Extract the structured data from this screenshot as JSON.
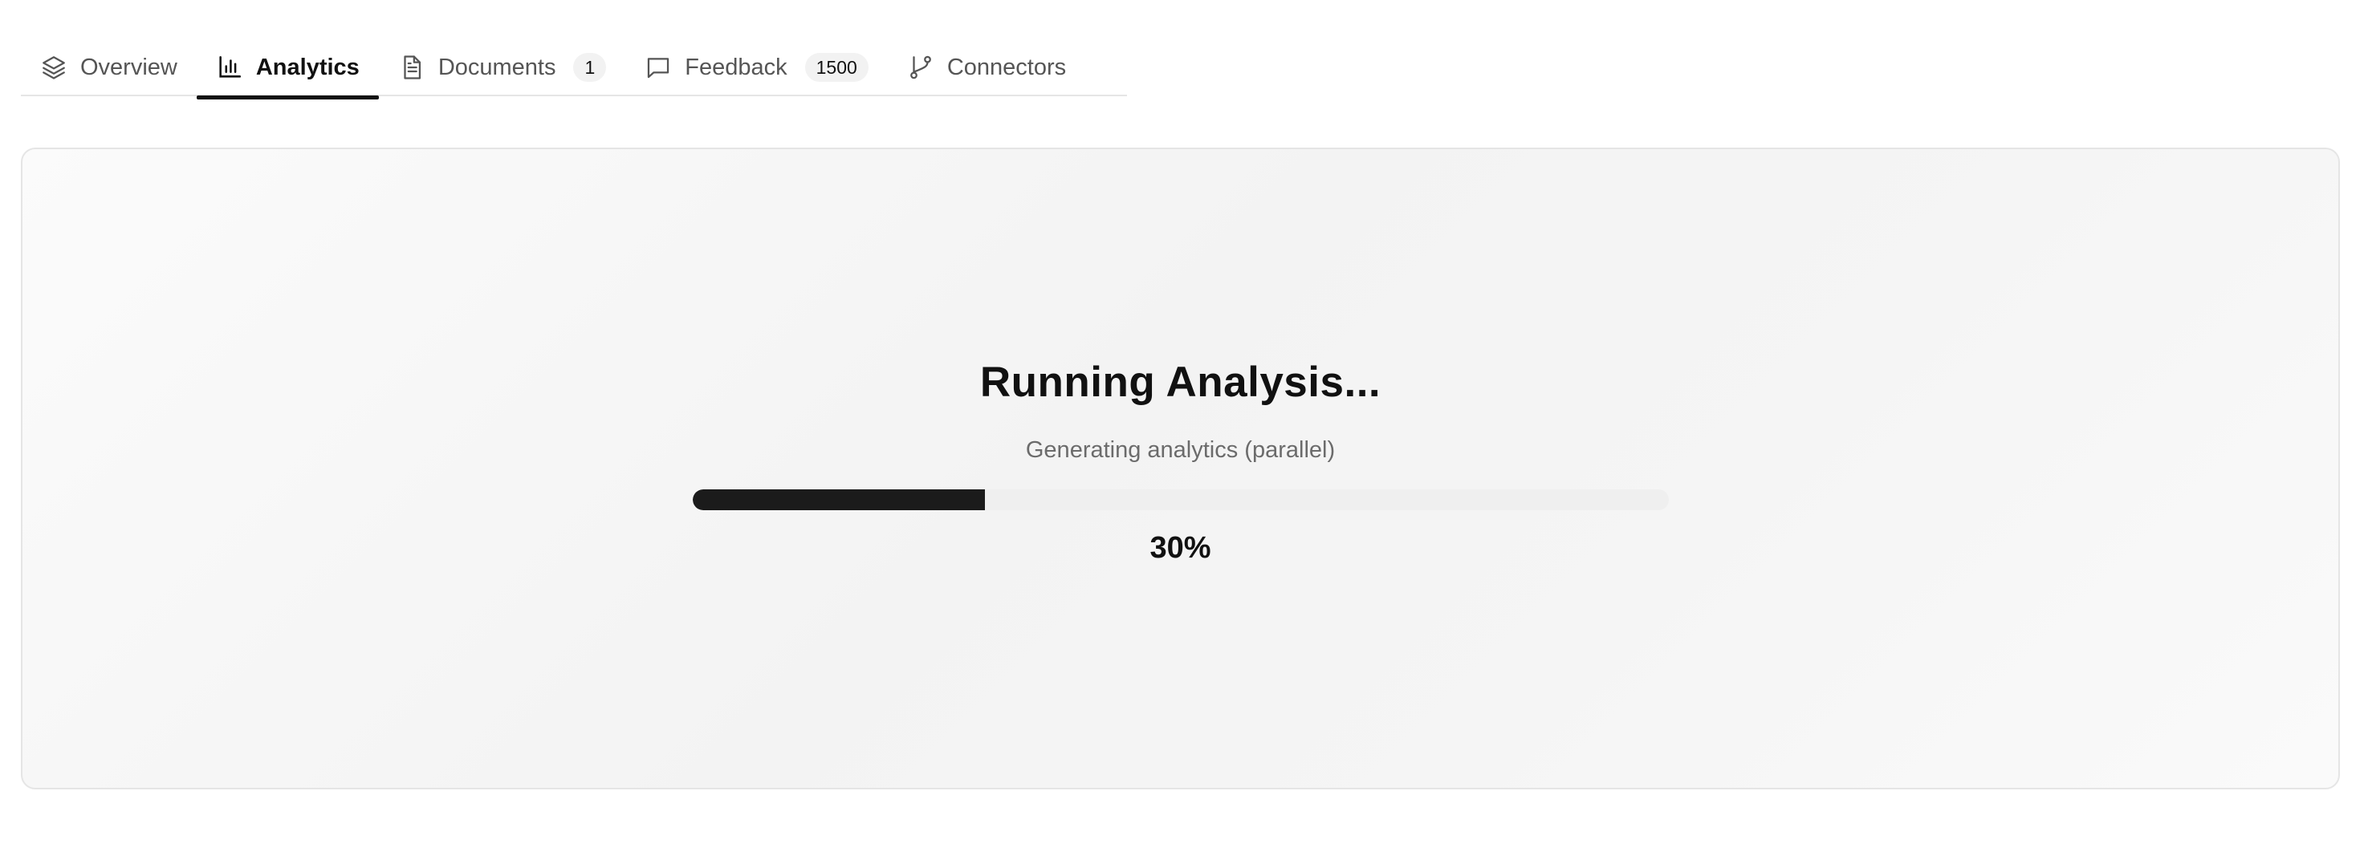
{
  "tabs": [
    {
      "label": "Overview",
      "icon": "layers-icon",
      "active": false
    },
    {
      "label": "Analytics",
      "icon": "bar-chart-icon",
      "active": true
    },
    {
      "label": "Documents",
      "icon": "document-icon",
      "badge": "1",
      "active": false
    },
    {
      "label": "Feedback",
      "icon": "message-square-icon",
      "badge": "1500",
      "active": false
    },
    {
      "label": "Connectors",
      "icon": "git-branch-icon",
      "active": false
    }
  ],
  "analysis": {
    "title": "Running Analysis...",
    "subtitle": "Generating analytics (parallel)",
    "progress_fraction": 0.3,
    "progress_label": "30%"
  },
  "colors": {
    "accent": "#111111",
    "progress_fill": "#1b1b1b",
    "progress_track": "#efefef",
    "muted_text": "#6b6b6b"
  }
}
